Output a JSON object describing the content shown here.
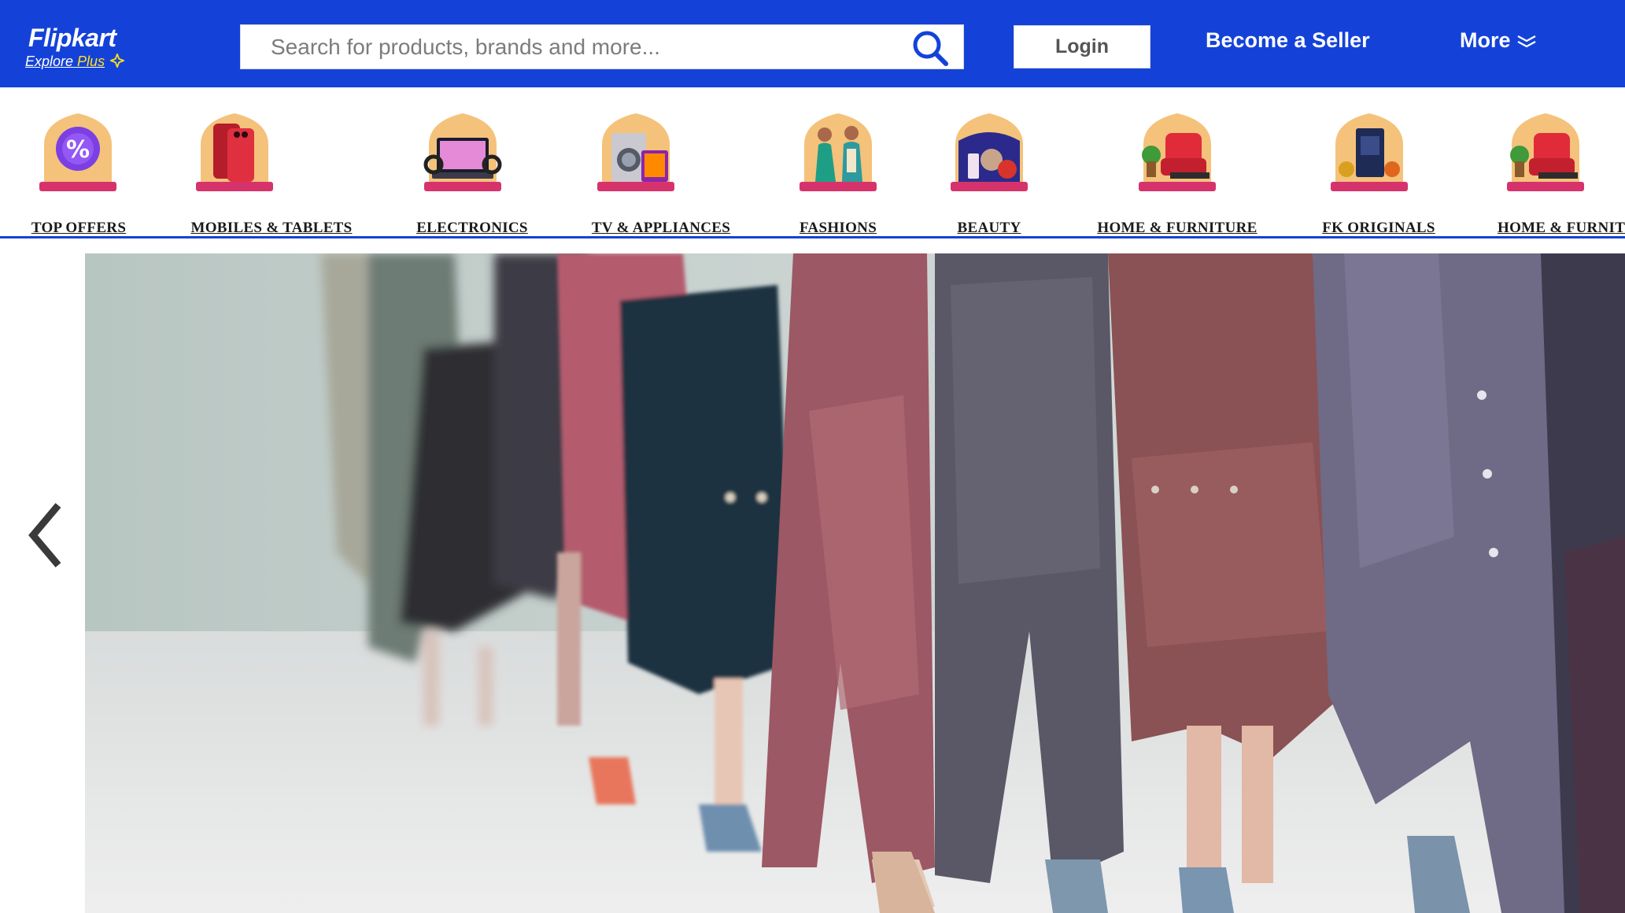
{
  "header": {
    "logo_name": "Flipkart",
    "logo_sub_left": "Explore",
    "logo_sub_right": "Plus",
    "search_placeholder": "Search for products, brands and more...",
    "search_icon": "search-icon",
    "login_label": "Login",
    "seller_label": "Become a Seller",
    "more_label": "More",
    "more_icon": "chevron-down-icon",
    "colors": {
      "brand_blue": "#1442d9",
      "plus_yellow": "#ffe11b"
    }
  },
  "categories": [
    {
      "label": "TOP OFFERS",
      "icon": "offer-badge-icon"
    },
    {
      "label": "MOBILES & TABLETS",
      "icon": "mobile-phone-icon"
    },
    {
      "label": "ELECTRONICS",
      "icon": "laptop-icon"
    },
    {
      "label": "TV & APPLIANCES",
      "icon": "washing-machine-icon"
    },
    {
      "label": "FASHIONS",
      "icon": "fashion-couple-icon"
    },
    {
      "label": "BEAUTY",
      "icon": "beauty-products-icon"
    },
    {
      "label": "HOME & FURNITURE",
      "icon": "armchair-icon"
    },
    {
      "label": "FK ORIGINALS",
      "icon": "fk-originals-icon"
    },
    {
      "label": "HOME & FURNIT",
      "icon": "armchair-icon"
    }
  ],
  "banner": {
    "image": "fashion-runway-photo",
    "prev_icon": "chevron-left-icon"
  }
}
